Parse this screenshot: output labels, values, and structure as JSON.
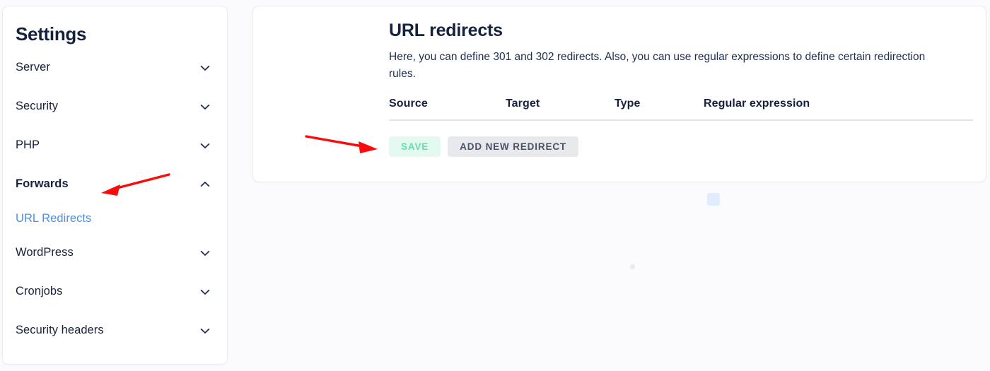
{
  "sidebar": {
    "title": "Settings",
    "items": [
      {
        "label": "Server",
        "icon": "chevron-down-icon",
        "expanded": false
      },
      {
        "label": "Security",
        "icon": "chevron-down-icon",
        "expanded": false
      },
      {
        "label": "PHP",
        "icon": "chevron-down-icon",
        "expanded": false
      },
      {
        "label": "Forwards",
        "icon": "chevron-up-icon",
        "expanded": true
      },
      {
        "label": "WordPress",
        "icon": "chevron-down-icon",
        "expanded": false
      },
      {
        "label": "Cronjobs",
        "icon": "chevron-down-icon",
        "expanded": false
      },
      {
        "label": "Security headers",
        "icon": "chevron-down-icon",
        "expanded": false
      }
    ],
    "sub_items": [
      {
        "label": "URL Redirects",
        "active": true
      }
    ]
  },
  "main": {
    "title": "URL redirects",
    "description": "Here, you can define 301 and 302 redirects. Also, you can use regular expressions to define certain redirection rules.",
    "table": {
      "columns": [
        "Source",
        "Target",
        "Type",
        "Regular expression"
      ],
      "rows": []
    },
    "buttons": {
      "save": "SAVE",
      "add_redirect": "ADD NEW REDIRECT"
    }
  },
  "annotations": {
    "arrow_color": "#fa0a0a",
    "arrow_sidebar_target": "Forwards",
    "arrow_button_target": "SAVE"
  },
  "colors": {
    "page_background": "#fbfbfd",
    "card_background": "#ffffff",
    "card_border": "#ececf0",
    "heading_navy": "#16213e",
    "link_blue": "#4a90e8",
    "save_button_background": "#e4faf0",
    "save_button_text": "#63dfae",
    "add_button_background": "#e8e9ec",
    "add_button_text": "#4a5168",
    "table_rule": "#e3e4e8",
    "annotation_red": "#fa0a0a"
  }
}
